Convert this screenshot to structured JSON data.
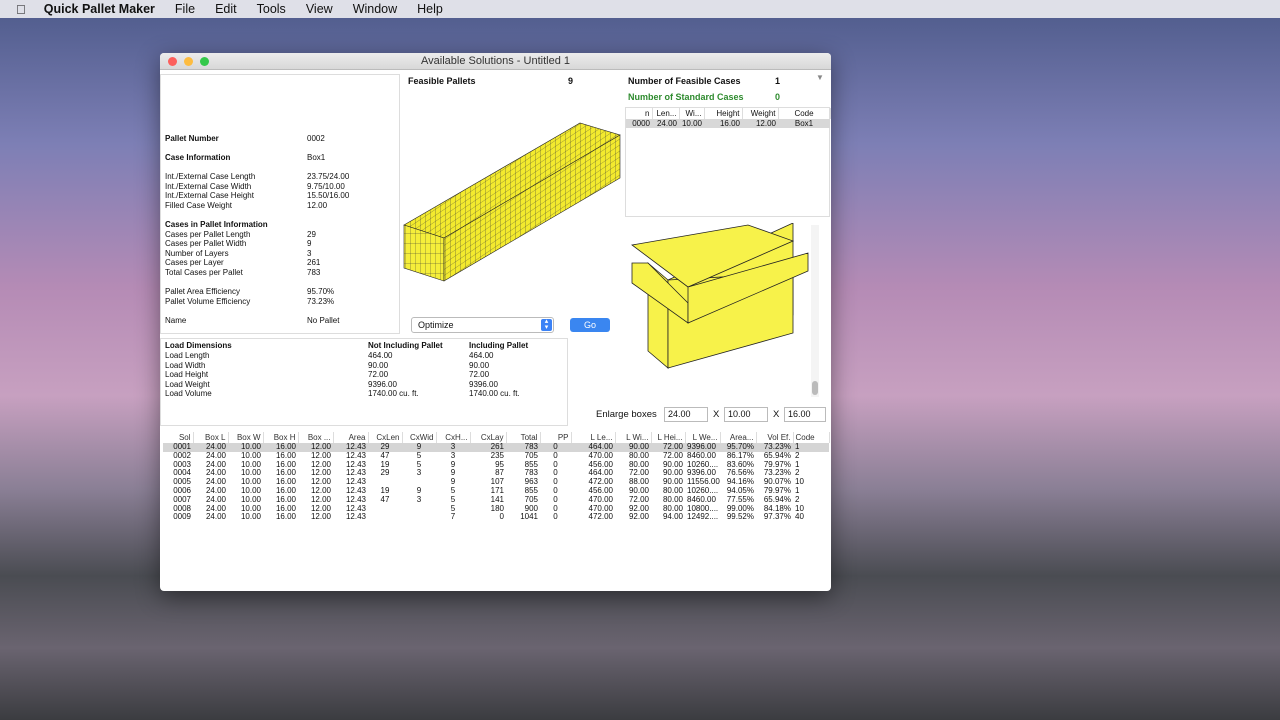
{
  "menubar": {
    "apple": "",
    "app": "Quick Pallet Maker",
    "items": [
      "File",
      "Edit",
      "Tools",
      "View",
      "Window",
      "Help"
    ]
  },
  "window": {
    "title": "Available Solutions - Untitled 1"
  },
  "info": {
    "pallet_number_label": "Pallet Number",
    "pallet_number": "0002",
    "case_info_label": "Case Information",
    "case_info": "Box1",
    "case_rows": [
      [
        "Int./External Case Length",
        "23.75/24.00"
      ],
      [
        "Int./External Case Width",
        "9.75/10.00"
      ],
      [
        "Int./External Case Height",
        "15.50/16.00"
      ],
      [
        "Filled Case Weight",
        "12.00"
      ]
    ],
    "cases_header": "Cases in Pallet Information",
    "cases_rows": [
      [
        "Cases per Pallet Length",
        "29"
      ],
      [
        "Cases per Pallet Width",
        "9"
      ],
      [
        "Number of Layers",
        "3"
      ],
      [
        "Cases per Layer",
        "261"
      ],
      [
        "Total Cases per Pallet",
        "783"
      ]
    ],
    "eff_rows": [
      [
        "Pallet Area Efficiency",
        "95.70%"
      ],
      [
        "Pallet Volume Efficiency",
        "73.23%"
      ]
    ],
    "name_label": "Name",
    "name": "No Pallet"
  },
  "feasible": {
    "label": "Feasible Pallets",
    "count": "9"
  },
  "feasible_cases": {
    "label": "Number of Feasible Cases",
    "count": "1"
  },
  "standard_cases": {
    "label": "Number of Standard Cases",
    "count": "0",
    "color": "#2e8b2e"
  },
  "cases_table": {
    "headers": [
      "n",
      "Len...",
      "Wi...",
      "Height",
      "Weight",
      "Code"
    ],
    "rows": [
      [
        "0000",
        "24.00",
        "10.00",
        "16.00",
        "12.00",
        "Box1"
      ]
    ]
  },
  "optimize": {
    "selected": "Optimize",
    "go": "Go"
  },
  "enlarge": {
    "label": "Enlarge boxes",
    "x": "X",
    "l": "24.00",
    "w": "10.00",
    "h": "16.00"
  },
  "load": {
    "title": "Load Dimensions",
    "col1": "Not Including Pallet",
    "col2": "Including Pallet",
    "rows": [
      [
        "Load Length",
        "464.00",
        "464.00"
      ],
      [
        "Load Width",
        "90.00",
        "90.00"
      ],
      [
        "Load Height",
        "72.00",
        "72.00"
      ],
      [
        "Load Weight",
        "9396.00",
        "9396.00"
      ],
      [
        "Load Volume",
        "1740.00 cu. ft.",
        "1740.00 cu. ft."
      ]
    ]
  },
  "solutions": {
    "headers": [
      "Sol",
      "Box L",
      "Box W",
      "Box H",
      "Box ...",
      "Area",
      "CxLen",
      "CxWid",
      "CxH...",
      "CxLay",
      "Total",
      "PP",
      "L Le...",
      "L Wi...",
      "L Hei...",
      "L We...",
      "Area...",
      "Vol Ef.",
      "Code"
    ],
    "rows": [
      [
        "0001",
        "24.00",
        "10.00",
        "16.00",
        "12.00",
        "12.43",
        "29",
        "9",
        "3",
        "261",
        "783",
        "0",
        "464.00",
        "90.00",
        "72.00",
        "9396.00",
        "95.70%",
        "73.23%",
        "1"
      ],
      [
        "0002",
        "24.00",
        "10.00",
        "16.00",
        "12.00",
        "12.43",
        "47",
        "5",
        "3",
        "235",
        "705",
        "0",
        "470.00",
        "80.00",
        "72.00",
        "8460.00",
        "86.17%",
        "65.94%",
        "2"
      ],
      [
        "0003",
        "24.00",
        "10.00",
        "16.00",
        "12.00",
        "12.43",
        "19",
        "5",
        "9",
        "95",
        "855",
        "0",
        "456.00",
        "80.00",
        "90.00",
        "10260....",
        "83.60%",
        "79.97%",
        "1"
      ],
      [
        "0004",
        "24.00",
        "10.00",
        "16.00",
        "12.00",
        "12.43",
        "29",
        "3",
        "9",
        "87",
        "783",
        "0",
        "464.00",
        "72.00",
        "90.00",
        "9396.00",
        "76.56%",
        "73.23%",
        "2"
      ],
      [
        "0005",
        "24.00",
        "10.00",
        "16.00",
        "12.00",
        "12.43",
        "",
        "",
        "9",
        "107",
        "963",
        "0",
        "472.00",
        "88.00",
        "90.00",
        "11556.00",
        "94.16%",
        "90.07%",
        "10"
      ],
      [
        "0006",
        "24.00",
        "10.00",
        "16.00",
        "12.00",
        "12.43",
        "19",
        "9",
        "5",
        "171",
        "855",
        "0",
        "456.00",
        "90.00",
        "80.00",
        "10260....",
        "94.05%",
        "79.97%",
        "1"
      ],
      [
        "0007",
        "24.00",
        "10.00",
        "16.00",
        "12.00",
        "12.43",
        "47",
        "3",
        "5",
        "141",
        "705",
        "0",
        "470.00",
        "72.00",
        "80.00",
        "8460.00",
        "77.55%",
        "65.94%",
        "2"
      ],
      [
        "0008",
        "24.00",
        "10.00",
        "16.00",
        "12.00",
        "12.43",
        "",
        "",
        "5",
        "180",
        "900",
        "0",
        "470.00",
        "92.00",
        "80.00",
        "10800....",
        "99.00%",
        "84.18%",
        "10"
      ],
      [
        "0009",
        "24.00",
        "10.00",
        "16.00",
        "12.00",
        "12.43",
        "",
        "",
        "7",
        "0",
        "1041",
        "0",
        "472.00",
        "92.00",
        "94.00",
        "12492....",
        "99.52%",
        "97.37%",
        "40"
      ]
    ]
  }
}
